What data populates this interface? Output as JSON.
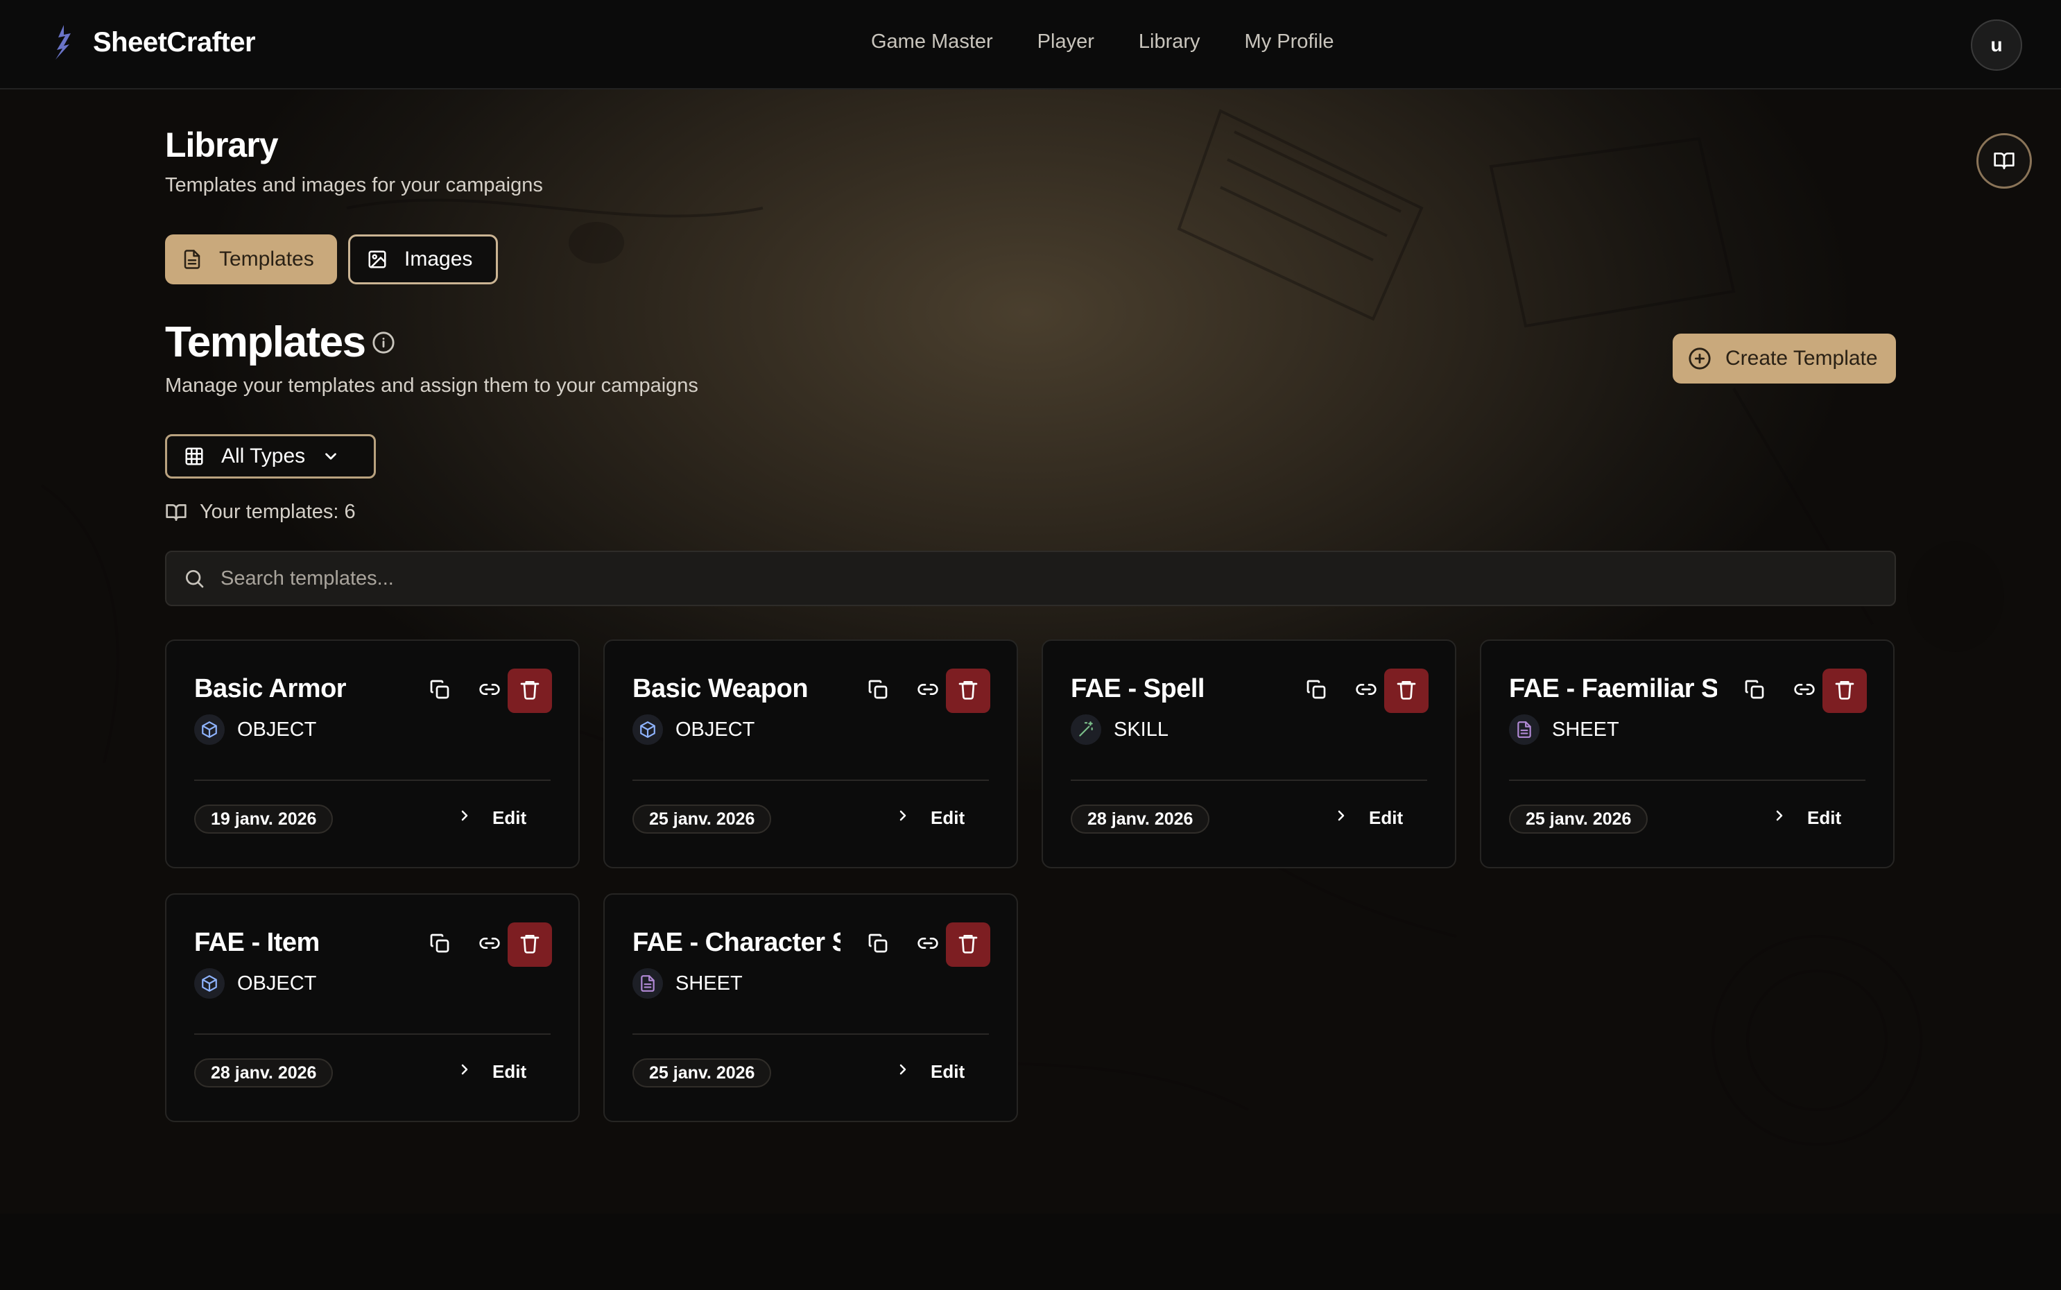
{
  "app": {
    "name": "SheetCrafter"
  },
  "nav": [
    "Game Master",
    "Player",
    "Library",
    "My Profile"
  ],
  "user": {
    "initial": "u"
  },
  "library": {
    "title": "Library",
    "subtitle": "Templates and images for your campaigns",
    "tabs": [
      {
        "label": "Templates",
        "icon": "file-text-icon",
        "active": true
      },
      {
        "label": "Images",
        "icon": "image-icon",
        "active": false
      }
    ]
  },
  "templates": {
    "title": "Templates",
    "subtitle": "Manage your templates and assign them to your campaigns",
    "create_label": "Create Template",
    "filter_value": "All Types",
    "count_label": "Your templates: 6",
    "search_placeholder": "Search templates...",
    "edit_label": "Edit",
    "items": [
      {
        "name": "Basic Armor",
        "type": "OBJECT",
        "type_icon": "cube-icon",
        "date": "19 janv. 2026"
      },
      {
        "name": "Basic Weapon",
        "type": "OBJECT",
        "type_icon": "cube-icon",
        "date": "25 janv. 2026"
      },
      {
        "name": "FAE - Spell",
        "type": "SKILL",
        "type_icon": "wand-icon",
        "date": "28 janv. 2026"
      },
      {
        "name": "FAE - Faemiliar Sheet",
        "type": "SHEET",
        "type_icon": "file-text-icon",
        "date": "25 janv. 2026"
      },
      {
        "name": "FAE - Item",
        "type": "OBJECT",
        "type_icon": "cube-icon",
        "date": "28 janv. 2026"
      },
      {
        "name": "FAE - Character Sheet",
        "type": "SHEET",
        "type_icon": "file-text-icon",
        "date": "25 janv. 2026"
      }
    ]
  },
  "colors": {
    "accent": "#c9a97c",
    "danger": "#7d1e22",
    "object_icon": "#8fb4ff",
    "skill_icon": "#7bbf8a",
    "sheet_icon": "#b28ad6"
  }
}
